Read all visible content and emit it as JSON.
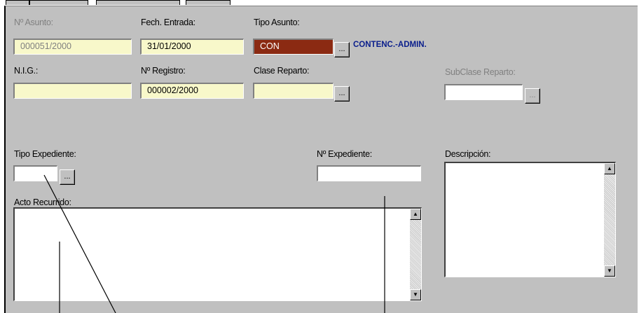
{
  "labels": {
    "num_asunto": "Nº Asunto:",
    "fech_entrada": "Fech. Entrada:",
    "tipo_asunto": "Tipo Asunto:",
    "nig": "N.I.G.:",
    "num_registro": "Nº Registro:",
    "clase_reparto": "Clase Reparto:",
    "subclase_reparto": "SubClase Reparto:",
    "tipo_expediente": "Tipo Expediente:",
    "num_expediente": "Nº Expediente:",
    "descripcion": "Descripción:",
    "acto_recurrido": "Acto Recurrido:"
  },
  "values": {
    "num_asunto": "000051/2000",
    "fech_entrada": "31/01/2000",
    "tipo_asunto_code": "CON",
    "tipo_asunto_desc": "CONTENC.-ADMIN.",
    "nig": "",
    "num_registro": "000002/2000",
    "clase_reparto": "",
    "subclase_reparto": "",
    "tipo_expediente": "",
    "num_expediente": ""
  },
  "buttons": {
    "ellipsis": "..."
  },
  "icons": {
    "scroll_up": "▲",
    "scroll_down": "▼"
  },
  "colors": {
    "panel": "#c0c0c0",
    "readonly_field": "#ffffd2",
    "code_field": "#8b2a12",
    "desc_text": "#0a1e8c"
  }
}
